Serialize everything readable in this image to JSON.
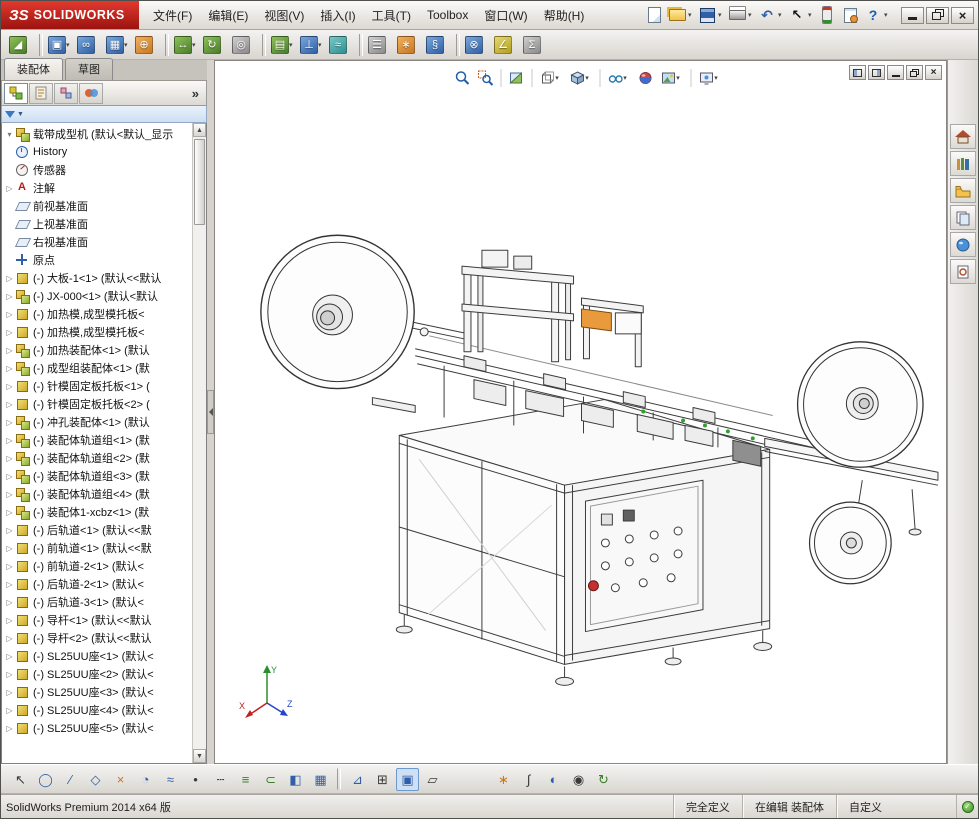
{
  "app": {
    "logo_mark": "ЗS",
    "logo_text": "SOLIDWORKS",
    "menus": [
      "文件(F)",
      "编辑(E)",
      "视图(V)",
      "插入(I)",
      "工具(T)",
      "Toolbox",
      "窗口(W)",
      "帮助(H)"
    ],
    "quick_icon_names": [
      "new-document-icon",
      "open-document-icon",
      "save-icon",
      "print-icon",
      "undo-icon",
      "select-cursor-icon",
      "rebuild-icon",
      "file-properties-icon",
      "help-icon"
    ],
    "window_button_names": [
      "minimize-button",
      "restore-button",
      "close-button"
    ]
  },
  "icons": {
    "dd": "▾",
    "undo": "↶",
    "cursor": "↖",
    "help": "?",
    "close": "×",
    "chevron": "»",
    "filter_arrow": "▼",
    "exp_open": "▾",
    "scroll_up": "▲",
    "scroll_down": "▼",
    "check": "✓",
    "collapse": ""
  },
  "toolbar": {
    "items": [
      {
        "name": "edit-component",
        "glyph": "◢",
        "cls": "c1",
        "arrow": ""
      },
      {
        "name": "separator",
        "glyph": "",
        "cls": "sepi",
        "arrow": ""
      },
      {
        "name": "insert-components",
        "glyph": "▣",
        "cls": "c2",
        "arrow": "▾"
      },
      {
        "name": "mate",
        "glyph": "∞",
        "cls": "c2",
        "arrow": ""
      },
      {
        "name": "linear-component-pattern",
        "glyph": "▦",
        "cls": "c2",
        "arrow": "▾"
      },
      {
        "name": "smart-fasteners",
        "glyph": "⊕",
        "cls": "c3",
        "arrow": ""
      },
      {
        "name": "separator",
        "glyph": "",
        "cls": "sepi",
        "arrow": ""
      },
      {
        "name": "move-component",
        "glyph": "↔",
        "cls": "c1",
        "arrow": "▾"
      },
      {
        "name": "rotate-component",
        "glyph": "↻",
        "cls": "c1",
        "arrow": ""
      },
      {
        "name": "show-hidden-components",
        "glyph": "◎",
        "cls": "c5",
        "arrow": ""
      },
      {
        "name": "separator",
        "glyph": "",
        "cls": "sepi",
        "arrow": ""
      },
      {
        "name": "assembly-features",
        "glyph": "▤",
        "cls": "c1",
        "arrow": "▾"
      },
      {
        "name": "reference-geometry",
        "glyph": "⊥",
        "cls": "c2",
        "arrow": "▾"
      },
      {
        "name": "new-motion-study",
        "glyph": "≈",
        "cls": "c6",
        "arrow": ""
      },
      {
        "name": "separator",
        "glyph": "",
        "cls": "sepi",
        "arrow": ""
      },
      {
        "name": "bill-of-materials",
        "glyph": "☰",
        "cls": "c5",
        "arrow": ""
      },
      {
        "name": "exploded-view",
        "glyph": "∗",
        "cls": "c3",
        "arrow": ""
      },
      {
        "name": "explode-line-sketch",
        "glyph": "§",
        "cls": "c2",
        "arrow": ""
      },
      {
        "name": "separator",
        "glyph": "",
        "cls": "sepi",
        "arrow": ""
      },
      {
        "name": "interference-detection",
        "glyph": "⊗",
        "cls": "c2",
        "arrow": ""
      },
      {
        "name": "measure",
        "glyph": "∠",
        "cls": "c4",
        "arrow": ""
      },
      {
        "name": "mass-properties",
        "glyph": "Σ",
        "cls": "c5",
        "arrow": ""
      }
    ]
  },
  "left_panel": {
    "doc_tabs": [
      {
        "label": "装配体",
        "cls": "active"
      },
      {
        "label": "草图",
        "cls": ""
      }
    ],
    "fm_tab_names": [
      "featuremanager-tree-tab",
      "propertymanager-tab",
      "configurationmanager-tab",
      "display-manager-tab"
    ],
    "tree": {
      "root_label": "载带成型机 (默认<默认_显示",
      "items": [
        {
          "exp": "",
          "type": "t-hist",
          "label": "History"
        },
        {
          "exp": "",
          "type": "t-sens",
          "label": "传感器"
        },
        {
          "exp": "▷",
          "type": "t-ann",
          "label": "注解"
        },
        {
          "exp": "",
          "type": "t-plane",
          "label": "前视基准面"
        },
        {
          "exp": "",
          "type": "t-plane",
          "label": "上视基准面"
        },
        {
          "exp": "",
          "type": "t-plane",
          "label": "右视基准面"
        },
        {
          "exp": "",
          "type": "t-origin",
          "label": "原点"
        },
        {
          "exp": "▷",
          "type": "t-part",
          "label": "(-) 大板-1<1> (默认<<默认"
        },
        {
          "exp": "▷",
          "type": "t-asm",
          "label": "(-) JX-000<1> (默认<默认"
        },
        {
          "exp": "▷",
          "type": "t-part",
          "label": "(-) 加热模,成型模托板<"
        },
        {
          "exp": "▷",
          "type": "t-part",
          "label": "(-) 加热模,成型模托板<"
        },
        {
          "exp": "▷",
          "type": "t-asm",
          "label": "(-) 加热装配体<1> (默认"
        },
        {
          "exp": "▷",
          "type": "t-asm",
          "label": "(-) 成型组装配体<1> (默"
        },
        {
          "exp": "▷",
          "type": "t-part",
          "label": "(-) 针模固定板托板<1> ("
        },
        {
          "exp": "▷",
          "type": "t-part",
          "label": "(-) 针模固定板托板<2> ("
        },
        {
          "exp": "▷",
          "type": "t-asm",
          "label": "(-) 冲孔装配体<1> (默认"
        },
        {
          "exp": "▷",
          "type": "t-asm",
          "label": "(-) 装配体轨道组<1> (默"
        },
        {
          "exp": "▷",
          "type": "t-asm",
          "label": "(-) 装配体轨道组<2> (默"
        },
        {
          "exp": "▷",
          "type": "t-asm",
          "label": "(-) 装配体轨道组<3> (默"
        },
        {
          "exp": "▷",
          "type": "t-asm",
          "label": "(-) 装配体轨道组<4> (默"
        },
        {
          "exp": "▷",
          "type": "t-asm",
          "label": "(-) 装配体1-xcbz<1> (默"
        },
        {
          "exp": "▷",
          "type": "t-part",
          "label": "(-) 后轨道<1> (默认<<默"
        },
        {
          "exp": "▷",
          "type": "t-part",
          "label": "(-) 前轨道<1> (默认<<默"
        },
        {
          "exp": "▷",
          "type": "t-part",
          "label": "(-) 前轨道-2<1> (默认<"
        },
        {
          "exp": "▷",
          "type": "t-part",
          "label": "(-) 后轨道-2<1> (默认<"
        },
        {
          "exp": "▷",
          "type": "t-part",
          "label": "(-) 后轨道-3<1> (默认<"
        },
        {
          "exp": "▷",
          "type": "t-part",
          "label": "(-) 导杆<1> (默认<<默认"
        },
        {
          "exp": "▷",
          "type": "t-part",
          "label": "(-) 导杆<2> (默认<<默认"
        },
        {
          "exp": "▷",
          "type": "t-part",
          "label": "(-) SL25UU座<1> (默认<"
        },
        {
          "exp": "▷",
          "type": "t-part",
          "label": "(-) SL25UU座<2> (默认<"
        },
        {
          "exp": "▷",
          "type": "t-part",
          "label": "(-) SL25UU座<3> (默认<"
        },
        {
          "exp": "▷",
          "type": "t-part",
          "label": "(-) SL25UU座<4> (默认<"
        },
        {
          "exp": "▷",
          "type": "t-part",
          "label": "(-) SL25UU座<5> (默认<"
        }
      ]
    }
  },
  "viewport": {
    "headsup_names": [
      "zoom-to-fit",
      "zoom-to-area",
      "section-view",
      "view-orientation",
      "display-style",
      "hide-show-items",
      "edit-appearance",
      "apply-scene",
      "view-settings"
    ],
    "triad": {
      "x": "X",
      "y": "Y",
      "z": "Z"
    }
  },
  "task_pane": {
    "item_names": [
      "solidworks-resources",
      "design-library",
      "file-explorer",
      "view-palette",
      "appearances-scenes",
      "custom-properties"
    ]
  },
  "bottom_toolbar": {
    "items": [
      {
        "name": "select-tool",
        "glyph": "↖",
        "cls": "g-dark"
      },
      {
        "name": "circle-tool",
        "glyph": "◯",
        "cls": "g-blue"
      },
      {
        "name": "line-tool",
        "glyph": "∕",
        "cls": "g-blue"
      },
      {
        "name": "polygon-tool",
        "glyph": "◇",
        "cls": "g-blue"
      },
      {
        "name": "trim-entities-tool",
        "glyph": "×",
        "cls": "g-orange"
      },
      {
        "name": "arc-tool",
        "glyph": "◔",
        "cls": "g-blue"
      },
      {
        "name": "spline-tool",
        "glyph": "≈",
        "cls": "g-blue"
      },
      {
        "name": "point-tool",
        "glyph": "•",
        "cls": "g-dark"
      },
      {
        "name": "centerline-tool",
        "glyph": "┄",
        "cls": "g-dark"
      },
      {
        "name": "convert-entities-tool",
        "glyph": "≡",
        "cls": "g-green"
      },
      {
        "name": "offset-entities-tool",
        "glyph": "⊂",
        "cls": "g-green"
      },
      {
        "name": "mirror-entities-tool",
        "glyph": "◧",
        "cls": "g-blue"
      },
      {
        "name": "linear-sketch-pattern-tool",
        "glyph": "▦",
        "cls": "g-blue"
      },
      {
        "name": "separator",
        "glyph": "",
        "cls": "sepi"
      },
      {
        "name": "chamfer-tool",
        "glyph": "⊿",
        "cls": "g-blue"
      },
      {
        "name": "grid-snap-tool",
        "glyph": "⊞",
        "cls": "g-dark"
      },
      {
        "name": "instant3d-tool",
        "glyph": "▣",
        "cls": "g-blue active"
      },
      {
        "name": "plane-tool",
        "glyph": "▱",
        "cls": "g-dark"
      },
      {
        "name": "spacer",
        "glyph": "",
        "cls": "gapi"
      },
      {
        "name": "exploded-view-tool",
        "glyph": "∗",
        "cls": "g-orange"
      },
      {
        "name": "curve-tool",
        "glyph": "∫",
        "cls": "g-dark"
      },
      {
        "name": "appearance-tool",
        "glyph": "◐",
        "cls": "g-blue"
      },
      {
        "name": "camera-tool",
        "glyph": "◉",
        "cls": "g-dark"
      },
      {
        "name": "update-tool",
        "glyph": "↻",
        "cls": "g-green"
      }
    ]
  },
  "status_bar": {
    "product": "SolidWorks Premium 2014 x64 版",
    "defined_state": "完全定义",
    "editing_state": "在编辑 装配体",
    "custom_label": "自定义"
  }
}
